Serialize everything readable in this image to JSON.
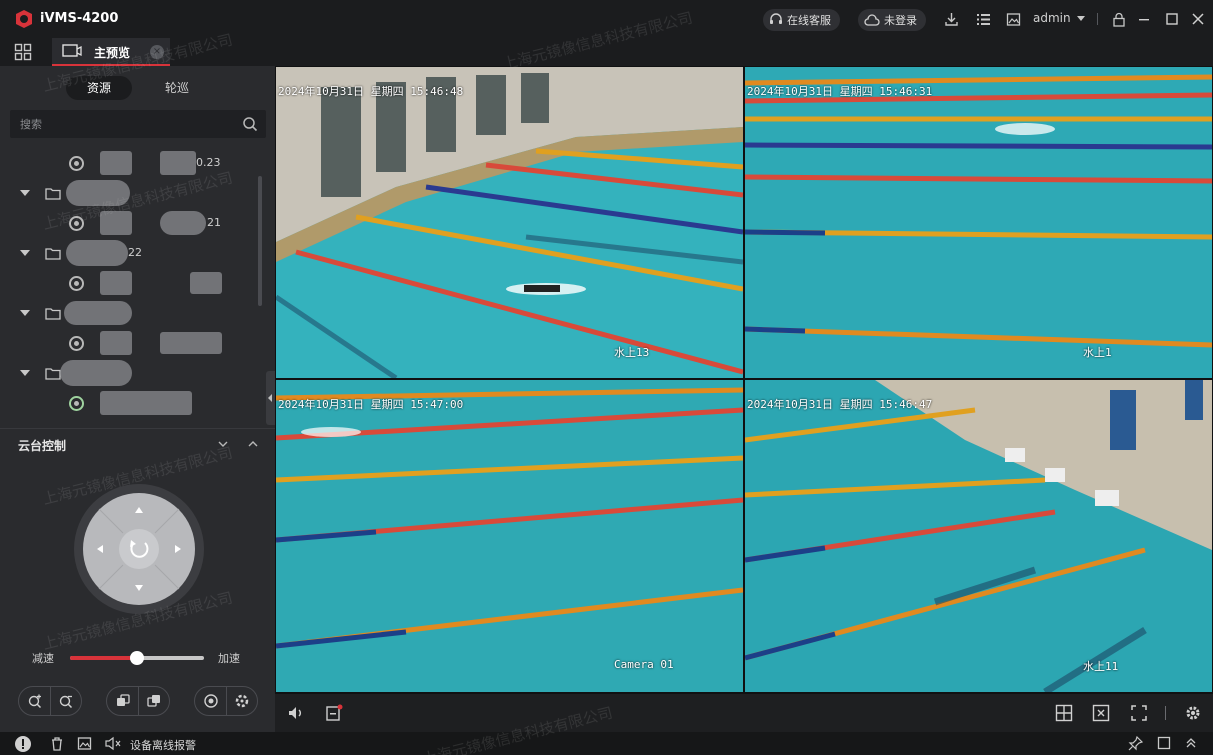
{
  "app": {
    "title": "iVMS-4200",
    "brand_color": "#d8333a",
    "logo_icon": "hikvision-logo-icon"
  },
  "titlebar": {
    "support_label": "在线客服",
    "cloud_label": "未登录",
    "user_name": "admin",
    "icons": [
      "headset-icon",
      "cloud-icon",
      "download-icon",
      "list-icon",
      "image-icon",
      "lock-icon",
      "minimize-icon",
      "maximize-icon",
      "close-icon"
    ]
  },
  "tabs": {
    "main_label": "主预览",
    "main_icon": "monitor-icon",
    "grid_icon": "grid-menu-icon"
  },
  "resource_panel": {
    "seg_resource": "资源",
    "seg_patrol": "轮巡",
    "search_placeholder": "搜索",
    "tree": [
      {
        "type": "camera",
        "suffix": "0.23"
      },
      {
        "type": "group",
        "suffix": ""
      },
      {
        "type": "camera",
        "suffix": "21"
      },
      {
        "type": "group",
        "suffix": "22"
      },
      {
        "type": "camera",
        "suffix": ""
      },
      {
        "type": "group",
        "suffix": ""
      },
      {
        "type": "camera",
        "suffix": ""
      },
      {
        "type": "group",
        "suffix": ""
      },
      {
        "type": "camera",
        "suffix": ""
      }
    ]
  },
  "ptz": {
    "title": "云台控制",
    "speed_slow": "减速",
    "speed_fast": "加速",
    "speed_level": 0.5
  },
  "video": {
    "cells": [
      {
        "timestamp": "2024年10月31日  星期四  15:46:48",
        "camera_name": "水上13"
      },
      {
        "timestamp": "2024年10月31日  星期四  15:46:31",
        "camera_name": "水上1"
      },
      {
        "timestamp": "2024年10月31日  星期四  15:47:00",
        "camera_name": "Camera 01"
      },
      {
        "timestamp": "2024年10月31日  星期四  15:46:47",
        "camera_name": "水上11"
      }
    ],
    "selected_cell": 3
  },
  "statusbar": {
    "alarm_text": "设备离线报警"
  },
  "watermark": {
    "text": "上海元镜像信息科技有限公司"
  }
}
